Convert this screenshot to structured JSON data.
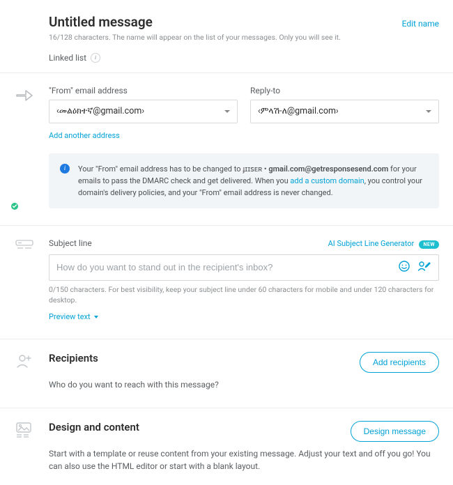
{
  "header": {
    "title": "Untitled message",
    "edit_link": "Edit name",
    "hint": "16/128 characters. The name will appear on the list of your messages. Only you will see it.",
    "linked_list_label": "Linked list"
  },
  "from_section": {
    "from_label": "\"From\" email address",
    "from_value": "‹መልዕክተኛ@gmail.com›",
    "reply_label": "Reply-to",
    "reply_value": "‹ምላሽ-ለ@gmail.com›",
    "add_another": "Add another address",
    "notice_pre": "Your \"From\" email address has to be changed to ",
    "notice_bold": "gmail.com@getresponsesend.com",
    "notice_prefix": "ɟɪɪꜱᴇʀ • ",
    "notice_mid": " for your emails to pass the DMARC check and get delivered. When you ",
    "notice_link": "add a custom domain",
    "notice_post": ", you control your domain's delivery policies, and your \"From\" email address is never changed."
  },
  "subject": {
    "label": "Subject line",
    "ai_link": "AI Subject Line Generator",
    "new_badge": "NEW",
    "placeholder": "How do you want to stand out in the recipient's inbox?",
    "hint": "0/150 characters. For best visibility, keep your subject line under 60 characters for mobile and under 120 characters for desktop.",
    "preview_text": "Preview text"
  },
  "recipients": {
    "title": "Recipients",
    "desc": "Who do you want to reach with this message?",
    "button": "Add recipients"
  },
  "design": {
    "title": "Design and content",
    "desc": "Start with a template or reuse content from your existing message. Adjust your text and off you go! You can also use the HTML editor or start with a blank layout.",
    "button": "Design message"
  }
}
